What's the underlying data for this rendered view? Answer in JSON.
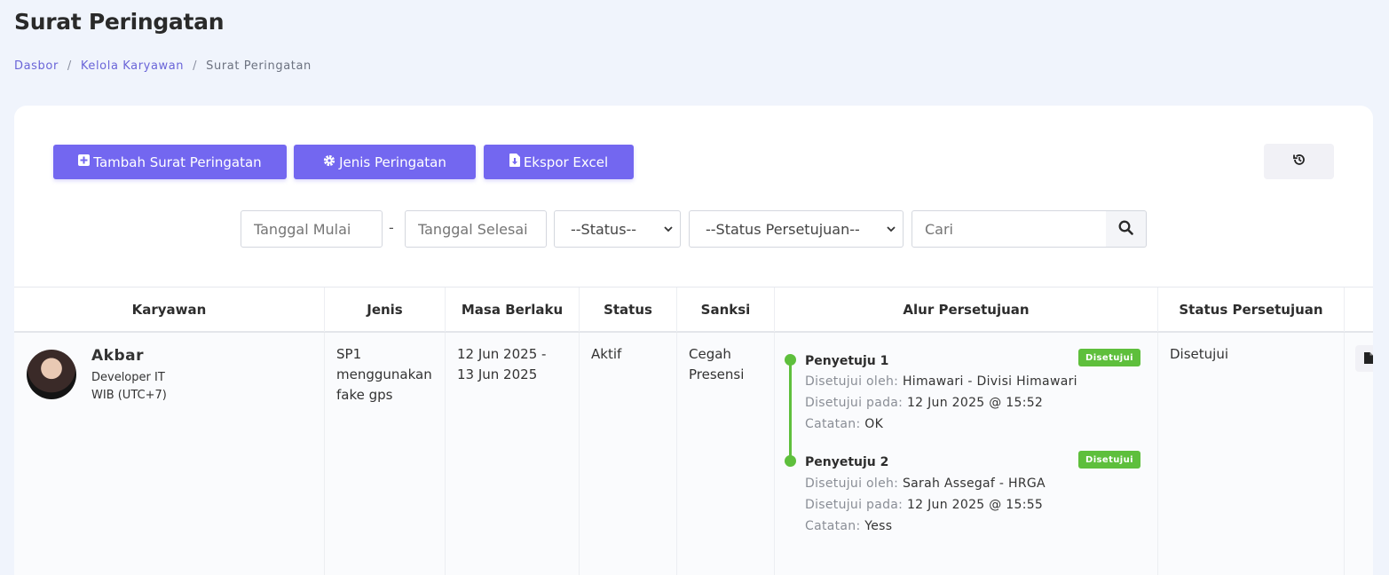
{
  "page": {
    "title": "Surat Peringatan"
  },
  "breadcrumb": {
    "items": [
      "Dasbor",
      "Kelola Karyawan",
      "Surat Peringatan"
    ],
    "separator": "/"
  },
  "toolbar": {
    "add_label": "Tambah Surat Peringatan",
    "types_label": "Jenis Peringatan",
    "export_label": "Ekspor Excel",
    "accent_color": "#7367f0"
  },
  "filters": {
    "start_date_placeholder": "Tanggal Mulai",
    "range_separator": "-",
    "end_date_placeholder": "Tanggal Selesai",
    "status_selected": "--Status--",
    "approval_status_selected": "--Status Persetujuan--",
    "search_placeholder": "Cari"
  },
  "table": {
    "headers": [
      "Karyawan",
      "Jenis",
      "Masa Berlaku",
      "Status",
      "Sanksi",
      "Alur Persetujuan",
      "Status Persetujuan"
    ],
    "rows": [
      {
        "employee": {
          "name": "Akbar",
          "role": "Developer IT",
          "timezone": "WIB (UTC+7)"
        },
        "type": "SP1 menggunakan fake gps",
        "validity": "12 Jun 2025 - 13 Jun 2025",
        "status": "Aktif",
        "sanction": "Cegah Presensi",
        "approval_flow": [
          {
            "title": "Penyetuju 1",
            "badge": "Disetujui",
            "approved_by_label": "Disetujui oleh:",
            "approved_by": "Himawari - Divisi Himawari",
            "approved_at_label": "Disetujui pada:",
            "approved_at": "12 Jun 2025 @ 15:52",
            "note_label": "Catatan:",
            "note": "OK"
          },
          {
            "title": "Penyetuju 2",
            "badge": "Disetujui",
            "approved_by_label": "Disetujui oleh:",
            "approved_by": "Sarah Assegaf - HRGA",
            "approved_at_label": "Disetujui pada:",
            "approved_at": "12 Jun 2025 @ 15:55",
            "note_label": "Catatan:",
            "note": "Yess"
          }
        ],
        "approval_status": "Disetujui"
      }
    ]
  },
  "colors": {
    "success": "#5ebf3c",
    "background": "#f0f4fc"
  }
}
